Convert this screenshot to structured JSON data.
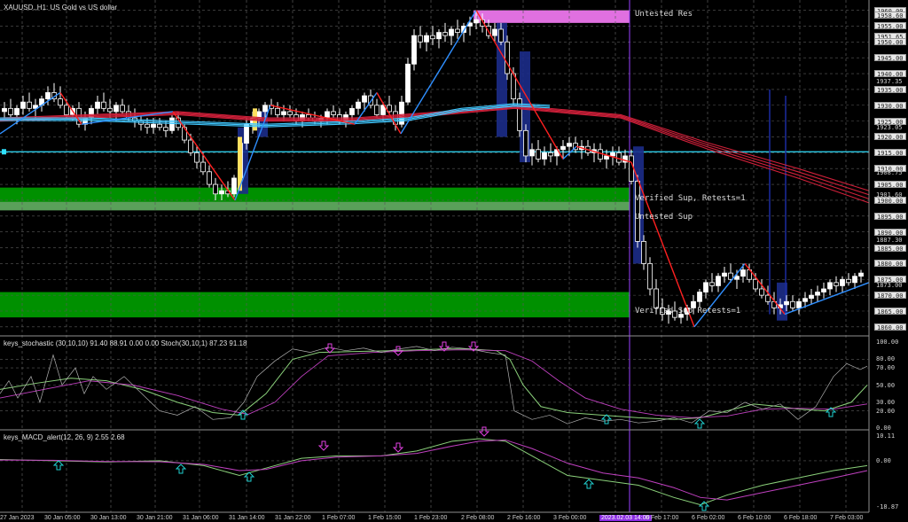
{
  "window": {
    "symbol_title": "XAUUSD.,H1: US Gold vs US dollar"
  },
  "zones": {
    "untested_res": "Untested Res",
    "verified_sup_1": "Verified Sup, Retests=1",
    "untested_sup": "Untested Sup",
    "verified_sup_2": "Verified Sup Retests=1"
  },
  "price_axis": {
    "labels": [
      "1960.00",
      "1958.60",
      "1955.00",
      "1951.65",
      "1950.00",
      "1945.00",
      "1940.00",
      "1937.35",
      "1935.00",
      "1930.00",
      "1925.00",
      "1923.05",
      "1920.00",
      "1915.00",
      "1910.00",
      "1908.75",
      "1905.00",
      "1901.60",
      "1900.00",
      "1895.00",
      "1890.00",
      "1887.30",
      "1885.00",
      "1880.00",
      "1875.00",
      "1873.00",
      "1870.00",
      "1865.00",
      "1860.00"
    ],
    "highlighted": [
      "1960.00",
      "1958.60",
      "1955.00",
      "1951.65",
      "1950.00",
      "1945.00",
      "1940.00",
      "1935.00",
      "1930.00",
      "1925.00",
      "1920.00",
      "1915.00",
      "1910.00",
      "1905.00",
      "1900.00",
      "1895.00",
      "1890.00",
      "1885.00",
      "1880.00",
      "1875.00",
      "1870.00",
      "1865.00",
      "1860.00"
    ]
  },
  "stochastic": {
    "title": "keys_stochastic (30,10,10) 91.40 88.91 0.00 0.00 Stoch(30,10,1) 87.23 91.18",
    "axis": [
      "100.00",
      "80.00",
      "70.00",
      "50.00",
      "30.00",
      "20.00",
      "0.00"
    ]
  },
  "macd": {
    "title": "keys_MACD_alert(12, 26, 9) 2.55 2.68",
    "axis": [
      "10.11",
      "0.00",
      "-18.87"
    ]
  },
  "time_axis": {
    "labels": [
      "27 Jan 2023",
      "30 Jan 05:00",
      "30 Jan 13:00",
      "30 Jan 21:00",
      "31 Jan 06:00",
      "31 Jan 14:00",
      "31 Jan 22:00",
      "1 Feb 07:00",
      "1 Feb 15:00",
      "1 Feb 23:00",
      "2 Feb 08:00",
      "2 Feb 16:00",
      "3 Feb 00:00",
      "2023.02.03 14:00",
      "6 Feb 17:00",
      "6 Feb 02:00",
      "6 Feb 10:00",
      "6 Feb 18:00",
      "7 Feb 03:00"
    ],
    "highlight_label": "2023.02.03 14:00"
  },
  "colors": {
    "background": "#000000",
    "grid": "#5a5a5a",
    "zone_green": "#009000",
    "zone_green_light": "#5aa05a",
    "zone_magenta": "#e070e0",
    "zigzag_blue": "#2f8fff",
    "zigzag_red": "#ff2020",
    "ma_red": "#d0203a",
    "ma_blue": "#40c8ff",
    "stoch_main": "#8ad07a",
    "stoch_signal": "#c040c0",
    "stoch_raw": "#b0b0b0",
    "arrow_cyan": "#20d0d0",
    "arrow_magenta": "#e040e0",
    "vline": "#9a40ff"
  }
}
